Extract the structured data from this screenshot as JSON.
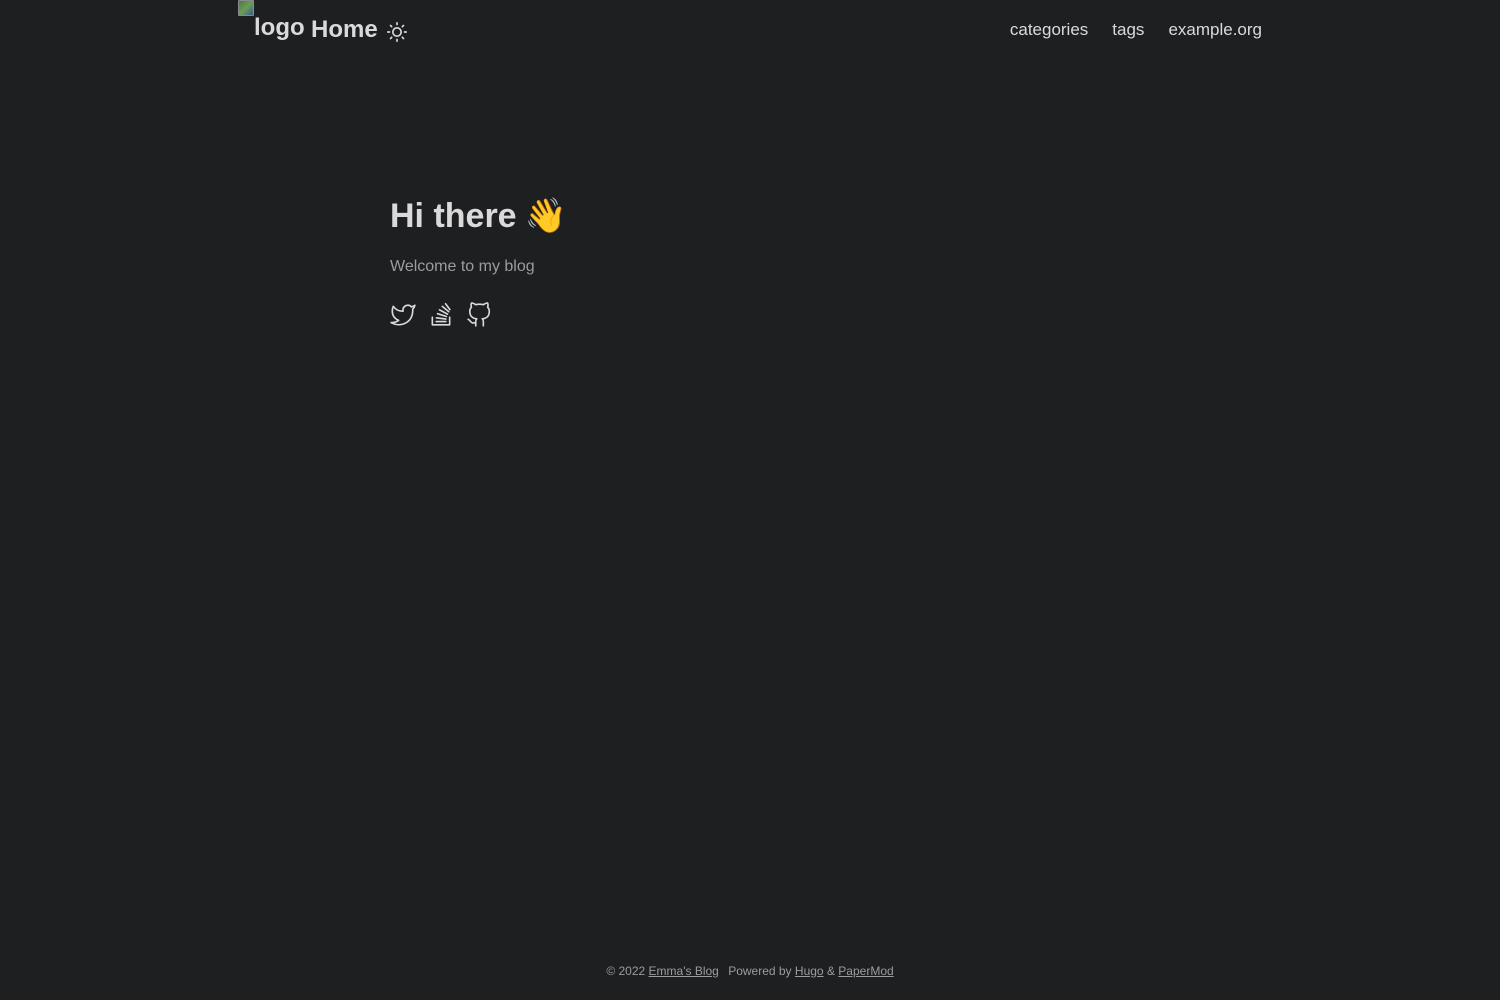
{
  "header": {
    "logo_alt": "logo",
    "home_label": "Home",
    "theme_toggle_icon": "sun-icon",
    "menu": [
      {
        "label": "categories"
      },
      {
        "label": "tags"
      },
      {
        "label": "example.org"
      }
    ]
  },
  "hero": {
    "title": "Hi there",
    "emoji": "👋",
    "subtitle": "Welcome to my blog"
  },
  "social": [
    {
      "icon": "twitter-icon"
    },
    {
      "icon": "stackoverflow-icon"
    },
    {
      "icon": "github-icon"
    }
  ],
  "footer": {
    "copyright": "© 2022",
    "site_name": "Emma's Blog",
    "powered_by": "Powered by",
    "hugo": "Hugo",
    "amp": "&",
    "papermod": "PaperMod"
  },
  "colors": {
    "background": "#1e1f21",
    "primary_text": "#dadadb",
    "secondary_text": "#9b9c9d"
  }
}
